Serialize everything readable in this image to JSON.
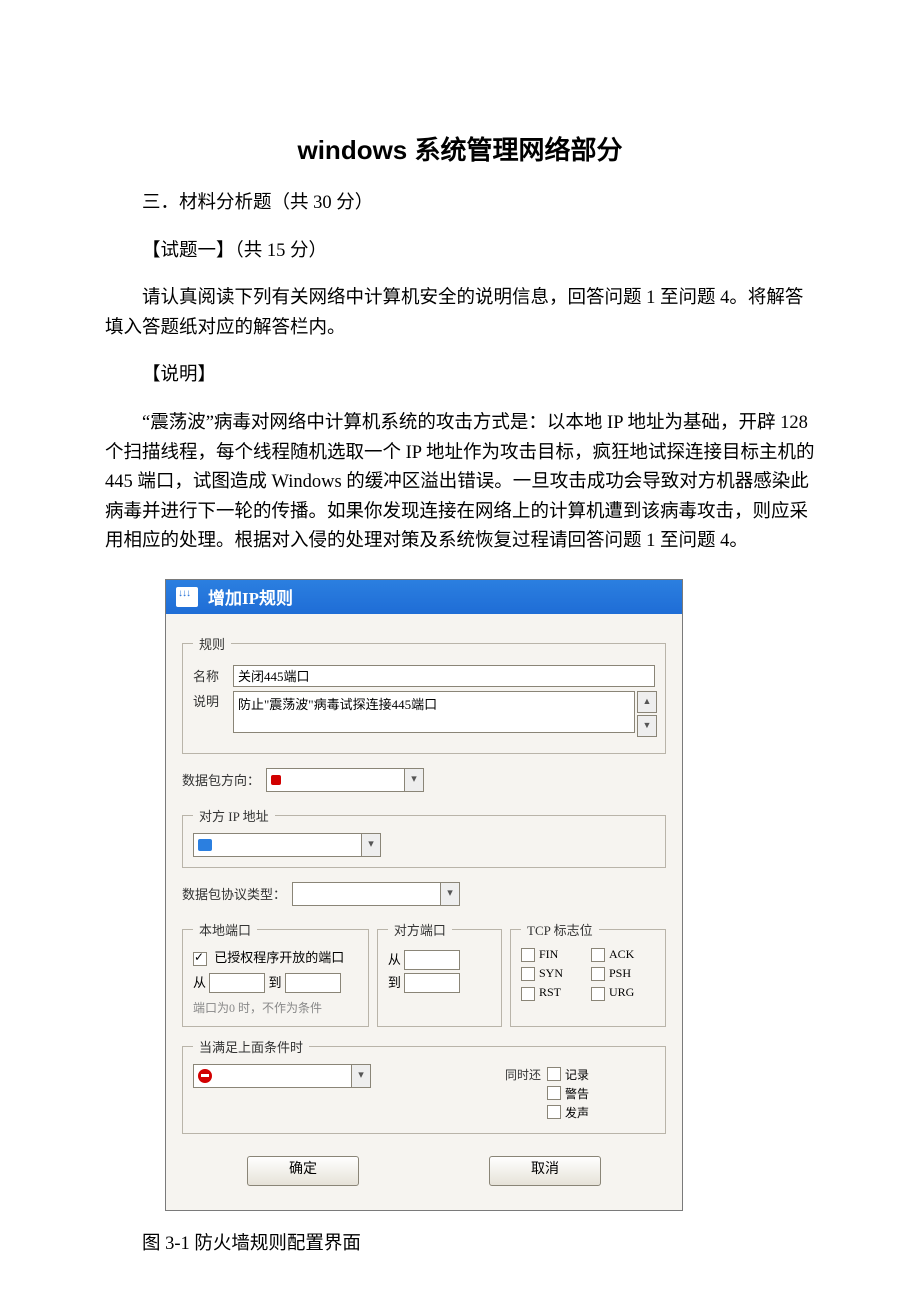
{
  "document": {
    "main_title": "windows 系统管理网络部分",
    "section_header": "三．材料分析题（共 30 分）",
    "question_header": "【试题一】（共 15 分）",
    "intro_para": "请认真阅读下列有关网络中计算机安全的说明信息，回答问题 1 至问题 4。将解答填入答题纸对应的解答栏内。",
    "shuoming_label": "【说明】",
    "shuoming_para": "“震荡波”病毒对网络中计算机系统的攻击方式是：以本地 IP 地址为基础，开辟 128 个扫描线程，每个线程随机选取一个 IP 地址作为攻击目标，疯狂地试探连接目标主机的 445 端口，试图造成 Windows 的缓冲区溢出错误。一旦攻击成功会导致对方机器感染此病毒并进行下一轮的传播。如果你发现连接在网络上的计算机遭到该病毒攻击，则应采用相应的处理。根据对入侵的处理对策及系统恢复过程请回答问题 1 至问题 4。",
    "figure_caption": "图 3-1 防火墙规则配置界面"
  },
  "dialog": {
    "title": "增加IP规则",
    "rule_group_legend": "规则",
    "name_label": "名称",
    "name_value": "关闭445端口",
    "desc_label": "说明",
    "desc_value": "防止\"震荡波\"病毒试探连接445端口",
    "direction_label": "数据包方向：",
    "ip_group_legend": "对方 IP 地址",
    "protocol_label": "数据包协议类型：",
    "local_port_legend": "本地端口",
    "authorized_label": "已授权程序开放的端口",
    "from_label": "从",
    "to_label": "到",
    "port_note": "端口为0 时，不作为条件",
    "remote_port_legend": "对方端口",
    "tcp_legend": "TCP 标志位",
    "tcp_flags": {
      "fin": "FIN",
      "syn": "SYN",
      "rst": "RST",
      "ack": "ACK",
      "psh": "PSH",
      "urg": "URG"
    },
    "condition_legend": "当满足上面条件时",
    "same_time_label": "同时还",
    "log_label": "记录",
    "alert_label": "警告",
    "sound_label": "发声",
    "ok_button": "确定",
    "cancel_button": "取消"
  }
}
